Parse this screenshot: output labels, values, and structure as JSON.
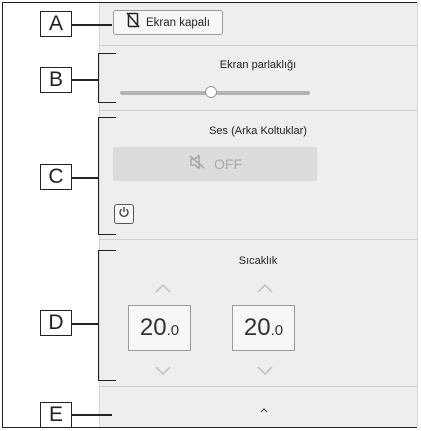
{
  "callouts": [
    "A",
    "B",
    "C",
    "D",
    "E"
  ],
  "screen_off": {
    "label": "Ekran kapalı",
    "icon": "screen-off-icon"
  },
  "brightness": {
    "title": "Ekran parlaklığı",
    "level": 0.48
  },
  "audio": {
    "title": "Ses (Arka Koltuklar)",
    "off_label": "OFF",
    "icon": "speaker-muted-icon",
    "power_icon": "power-icon"
  },
  "temperature": {
    "title": "Sıcaklık",
    "left": {
      "int": "20",
      "dec": ".0"
    },
    "right": {
      "int": "20",
      "dec": ".0"
    }
  },
  "collapse_icon": "chevron-up-icon",
  "colors": {
    "panel": "#eeeeee",
    "disabled_button": "#dcdcdc",
    "chevron": "#c4c4c4"
  }
}
